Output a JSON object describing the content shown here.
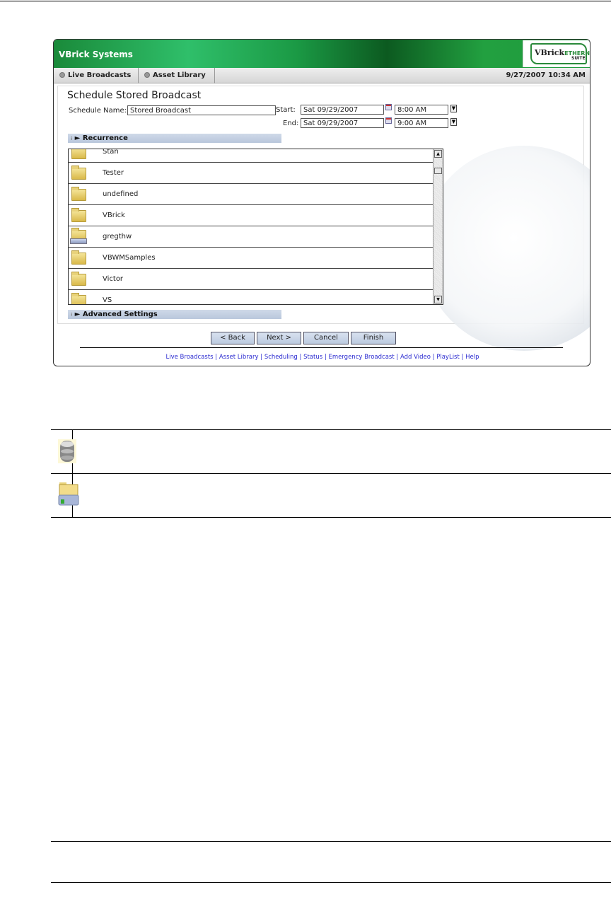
{
  "app": {
    "title": "VBrick Systems",
    "logo": "VBrick EtherneTV Suite",
    "datetime": "9/27/2007 10:34 AM"
  },
  "nav": {
    "tabs": [
      {
        "label": "Live Broadcasts"
      },
      {
        "label": "Asset Library"
      }
    ]
  },
  "form": {
    "title": "Schedule Stored Broadcast",
    "name_label": "Schedule Name:",
    "name_value": "Stored Broadcast",
    "start_label": "Start:",
    "start_date": "Sat 09/29/2007",
    "start_time": "8:00 AM",
    "end_label": "End:",
    "end_date": "Sat 09/29/2007",
    "end_time": "9:00 AM",
    "recurrence": "Recurrence",
    "advanced": "Advanced Settings"
  },
  "list": {
    "items": [
      {
        "label": "Stan",
        "icon": "folder-icon"
      },
      {
        "label": "Tester",
        "icon": "folder-icon"
      },
      {
        "label": "undefined",
        "icon": "folder-icon"
      },
      {
        "label": "VBrick",
        "icon": "folder-icon"
      },
      {
        "label": "gregthw",
        "icon": "network-folder-icon"
      },
      {
        "label": "VBWMSamples",
        "icon": "folder-icon"
      },
      {
        "label": "Victor",
        "icon": "folder-icon"
      },
      {
        "label": "VS",
        "icon": "folder-icon"
      }
    ]
  },
  "buttons": {
    "back": "< Back",
    "next": "Next >",
    "cancel": "Cancel",
    "finish": "Finish"
  },
  "footer_links": [
    "Live Broadcasts",
    "Asset Library",
    "Scheduling",
    "Status",
    "Emergency Broadcast",
    "Add Video",
    "PlayList",
    "Help"
  ],
  "legend_table": {
    "rows": [
      {
        "icon": "database-icon"
      },
      {
        "icon": "network-folder-icon"
      }
    ]
  }
}
